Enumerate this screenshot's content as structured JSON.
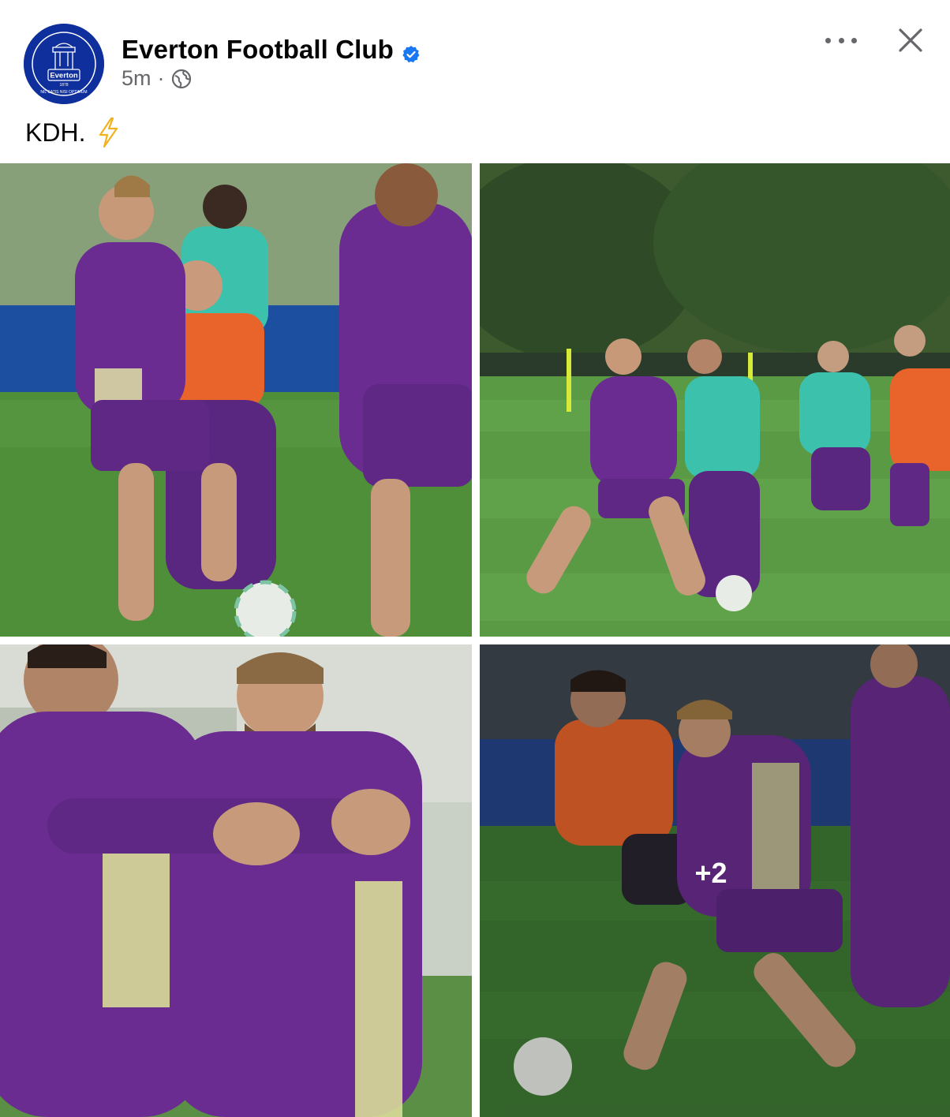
{
  "post": {
    "page_name": "Everton Football Club",
    "timestamp": "5m",
    "separator": "·",
    "audience_icon": "globe-icon",
    "verified_icon": "verified-badge-icon",
    "caption": "KDH.",
    "caption_emoji": "lightning-bolt-icon"
  },
  "avatar": {
    "crest_text": "Everton",
    "crest_year": "1878",
    "crest_motto": "NIL SATIS NISI OPTIMUM"
  },
  "header_actions": {
    "more_icon": "more-options-icon",
    "close_icon": "close-icon"
  },
  "gallery": {
    "photos": [
      {
        "alt": "Training photo 1"
      },
      {
        "alt": "Training photo 2"
      },
      {
        "alt": "Training photo 3"
      },
      {
        "alt": "Training photo 4"
      }
    ],
    "more_count": "+2"
  },
  "colors": {
    "brand_blue": "#0e2f9c",
    "verified_blue": "#1877f2",
    "secondary_text": "#65676b",
    "kit_purple": "#6b2c91",
    "bib_orange": "#e8642a",
    "bib_teal": "#3cc1ad",
    "pitch_green": "#4f8f3a"
  }
}
